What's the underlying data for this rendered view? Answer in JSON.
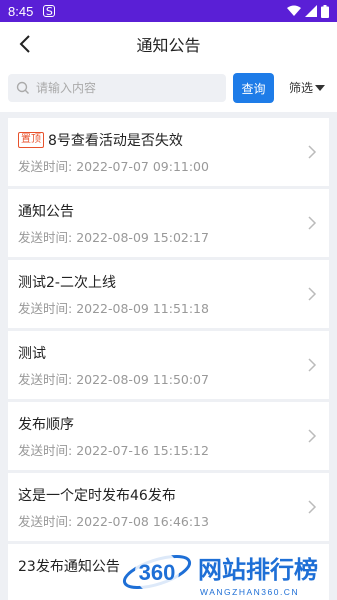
{
  "status_bar": {
    "time": "8:45",
    "sim_icon_glyph": "S",
    "colors": {
      "background": "#5a1fd6"
    }
  },
  "header": {
    "title": "通知公告"
  },
  "search": {
    "placeholder": "请输入内容",
    "value": "",
    "query_label": "查询",
    "filter_label": "筛选",
    "accent_color": "#1e7ce8"
  },
  "notices": [
    {
      "pinned": true,
      "badge": "置顶",
      "title": "8号查看活动是否失效",
      "time_label": "发送时间:",
      "time": "2022-07-07 09:11:00"
    },
    {
      "pinned": false,
      "badge": "",
      "title": "通知公告",
      "time_label": "发送时间:",
      "time": "2022-08-09 15:02:17"
    },
    {
      "pinned": false,
      "badge": "",
      "title": "测试2-二次上线",
      "time_label": "发送时间:",
      "time": "2022-08-09 11:51:18"
    },
    {
      "pinned": false,
      "badge": "",
      "title": "测试",
      "time_label": "发送时间:",
      "time": "2022-08-09 11:50:07"
    },
    {
      "pinned": false,
      "badge": "",
      "title": "发布顺序",
      "time_label": "发送时间:",
      "time": "2022-07-16 15:15:12"
    },
    {
      "pinned": false,
      "badge": "",
      "title": "这是一个定时发布46发布",
      "time_label": "发送时间:",
      "time": "2022-07-08 16:46:13"
    },
    {
      "pinned": false,
      "badge": "",
      "title": "23发布通知公告",
      "time_label": "",
      "time": ""
    }
  ],
  "watermark": {
    "logo_number": "360",
    "brand": "网站排行榜",
    "domain": "WANGZHAN360.CN"
  }
}
